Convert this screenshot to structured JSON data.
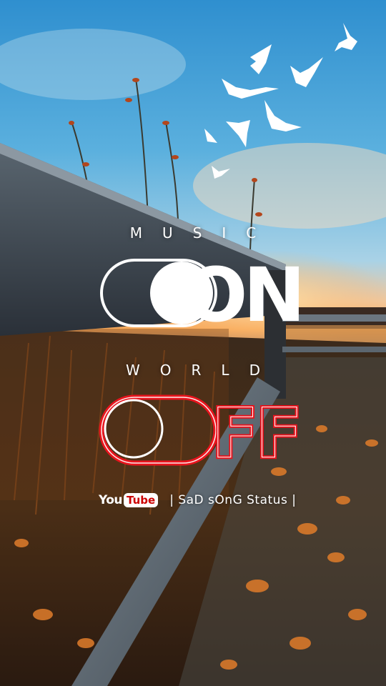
{
  "top_label": "MUSIC",
  "on_text": "ON",
  "middle_label": "WORLD",
  "off_text": "FF",
  "youtube_logo": {
    "you": "You",
    "tube": "Tube"
  },
  "channel_name": "| SaD sOnG Status |",
  "colors": {
    "on": "#ffffff",
    "off_outline": "#e8141d",
    "sky": "#3f9bd6",
    "sunset": "#f3b55a"
  },
  "icons": [
    "bird-icon",
    "youtube-logo"
  ]
}
